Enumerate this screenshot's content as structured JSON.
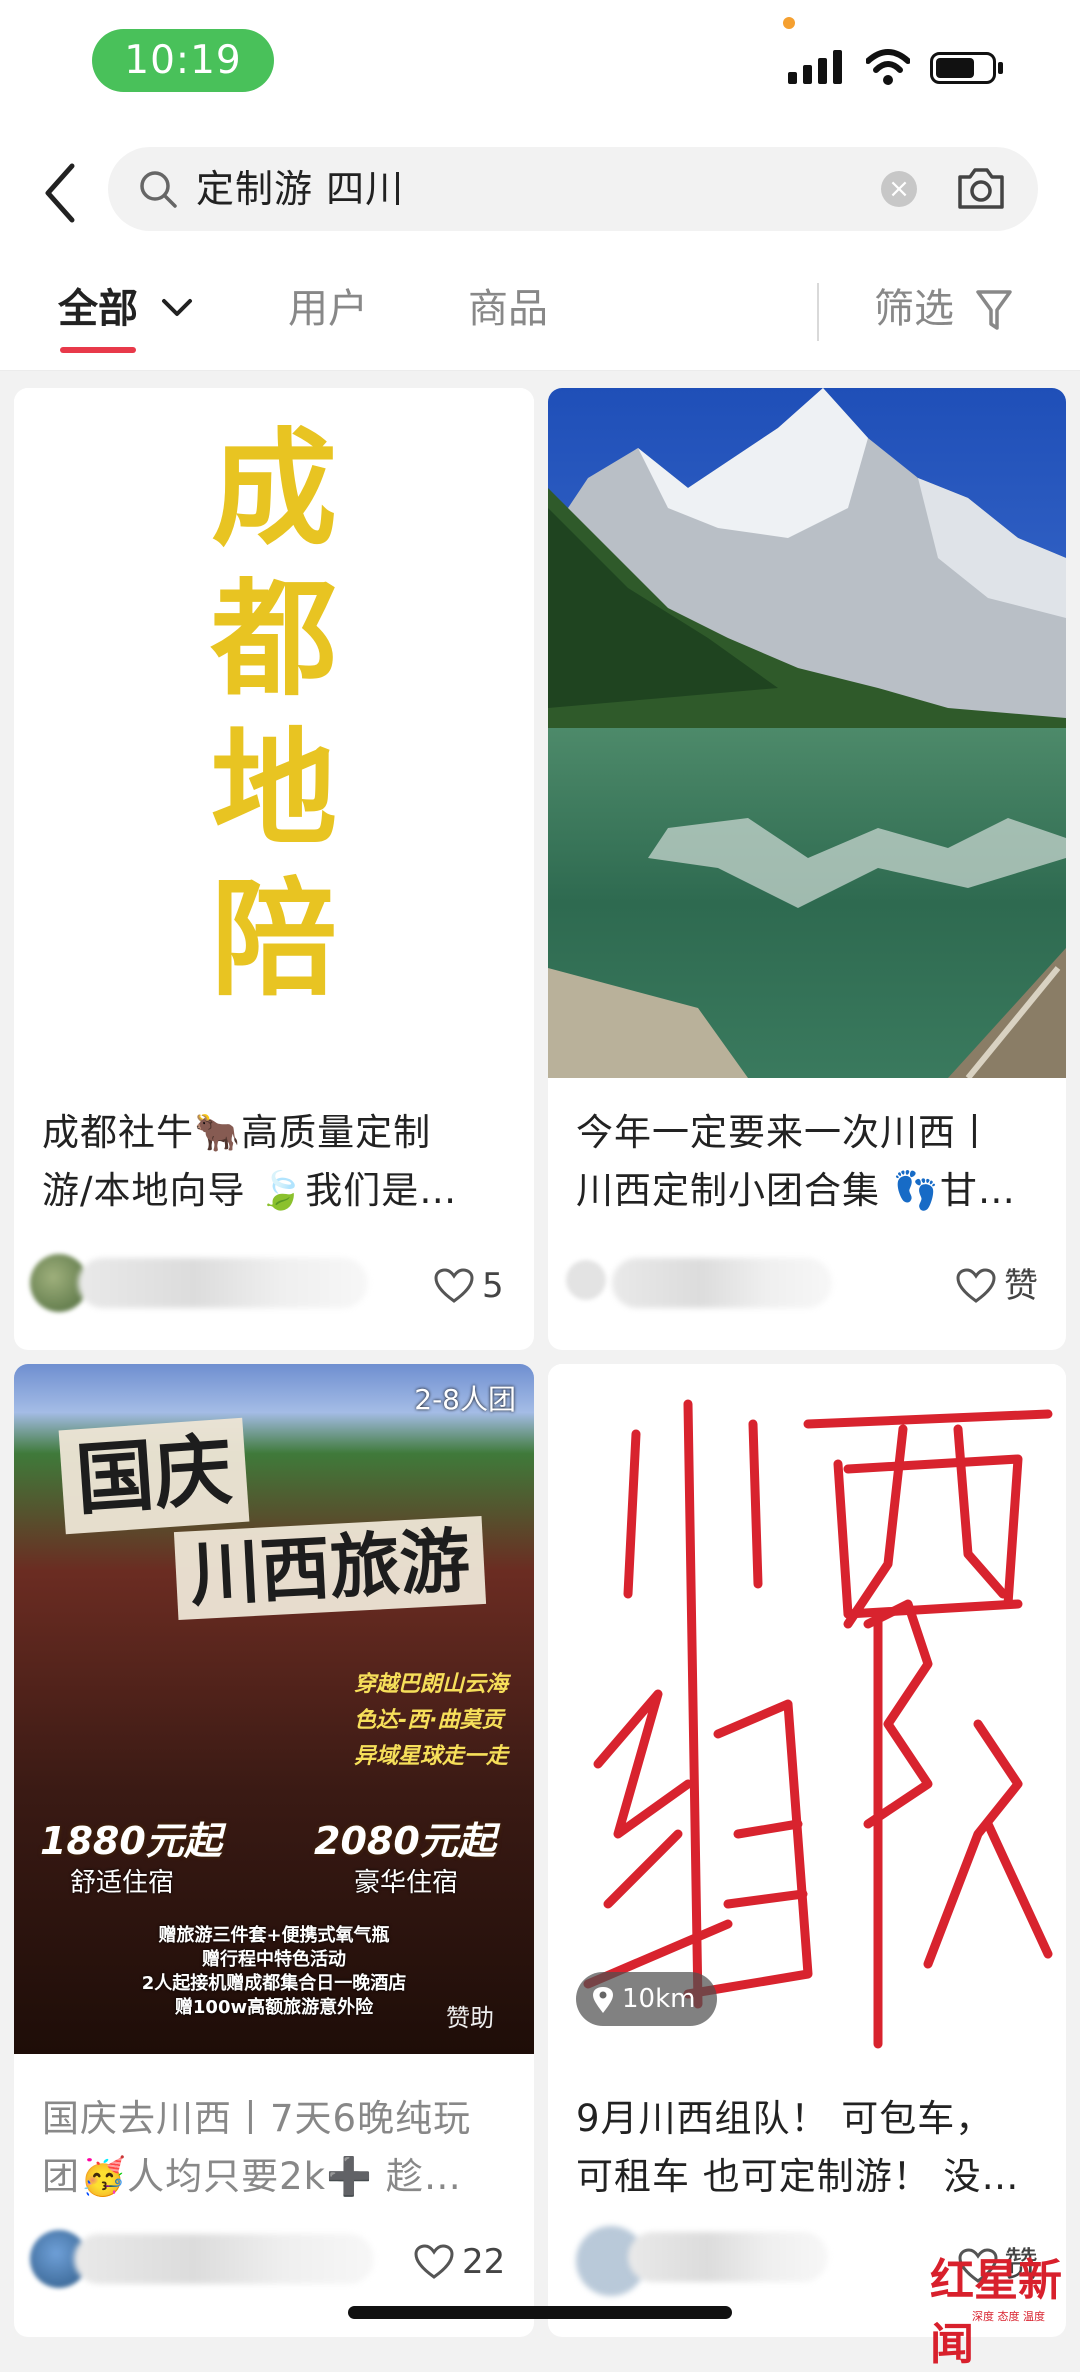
{
  "status_bar": {
    "time": "10:19"
  },
  "search": {
    "query": "定制游 四川",
    "clear_symbol": "×"
  },
  "tabs": {
    "all_label": "全部",
    "users_label": "用户",
    "goods_label": "商品",
    "filter_label": "筛选"
  },
  "cards": [
    {
      "calligraphy": [
        "成",
        "都",
        "地",
        "陪"
      ],
      "title": "成都社牛🐂高质量定制\n游/本地向导 🍃我们是…",
      "likes": "5"
    },
    {
      "title": "今年一定要来一次川西丨\n川西定制小团合集 👣甘…",
      "likes": "赞"
    },
    {
      "poster": {
        "badge": "2-8人团",
        "title": "国庆",
        "subtitle": "川西旅游",
        "route": [
          "穿越巴朗山云海",
          "色达-西·曲莫贡",
          "异域星球走一走"
        ],
        "price_left": "1880元起",
        "price_left_caption": "舒适住宿",
        "price_right": "2080元起",
        "price_right_caption": "豪华住宿",
        "notes": "赠旅游三件套+便携式氧气瓶\n赠行程中特色活动\n2人起接机赠成都集合日一晚酒店\n赠100w高额旅游意外险",
        "sponsor": "赞助"
      },
      "title": "国庆去川西丨7天6晚纯玩\n团🥳人均只要2k➕ 趁…",
      "likes": "22"
    },
    {
      "handwriting": [
        "川",
        "西",
        "组",
        "队"
      ],
      "distance": "10km",
      "title": "9月川西组队！ 可包车，\n可租车 也可定制游！ 没…",
      "likes": "赞"
    }
  ],
  "watermark": {
    "brand": "红星新闻",
    "tagline": "深度 态度 温度"
  },
  "colors": {
    "accent": "#e8394a",
    "time_pill": "#49c15a",
    "calligraphy": "#e8c422",
    "handwriting": "#d8232e"
  }
}
